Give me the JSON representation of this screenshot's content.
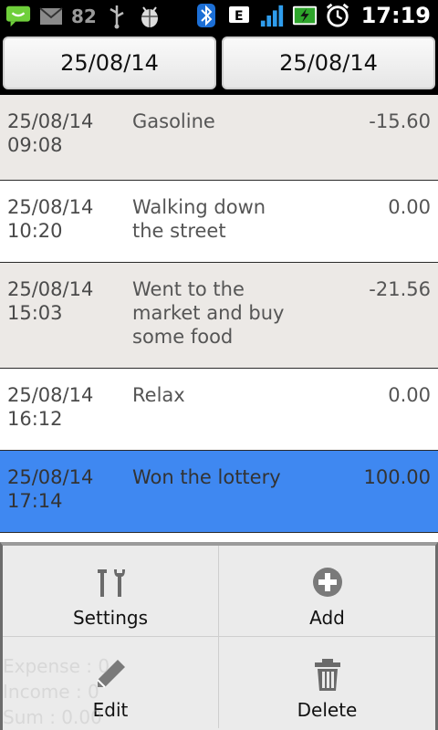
{
  "status_bar": {
    "battery_level": "82",
    "time": "17:19",
    "network_type": "E",
    "icons": [
      "message-icon",
      "gmail-icon",
      "usb-icon",
      "debug-icon",
      "bluetooth-icon",
      "network-e-icon",
      "signal-icon",
      "battery-charging-icon",
      "alarm-icon"
    ]
  },
  "header": {
    "from_date": "25/08/14",
    "to_date": "25/08/14"
  },
  "entries": [
    {
      "date": "25/08/14",
      "time": "09:08",
      "description": "Gasoline",
      "amount": "-15.60"
    },
    {
      "date": "25/08/14",
      "time": "10:20",
      "description": "Walking down the street",
      "amount": "0.00"
    },
    {
      "date": "25/08/14",
      "time": "15:03",
      "description": "Went to the market and buy some food",
      "amount": "-21.56"
    },
    {
      "date": "25/08/14",
      "time": "16:12",
      "description": "Relax",
      "amount": "0.00"
    },
    {
      "date": "25/08/14",
      "time": "17:14",
      "description": "Won the lottery",
      "amount": "100.00",
      "selected": true
    }
  ],
  "summary": {
    "expense_label": "Expense : 0",
    "income_label": "Income : 0",
    "sum_label": "Sum : 0.00"
  },
  "menu": {
    "settings": "Settings",
    "add": "Add",
    "edit": "Edit",
    "delete": "Delete"
  },
  "colors": {
    "selected_row": "#3f88f1",
    "shaded_row": "#ece9e6",
    "white_row": "#ffffff"
  }
}
